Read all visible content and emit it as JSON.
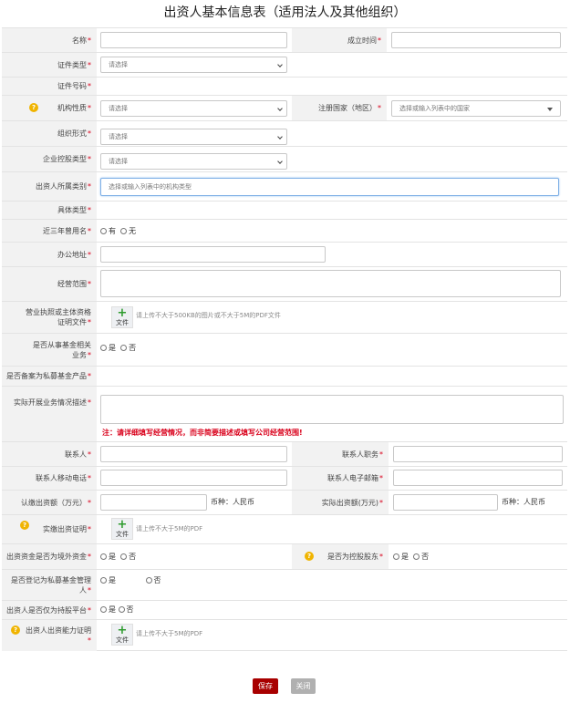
{
  "title": "出资人基本信息表（适用法人及其他组织）",
  "star": "*",
  "help_glyph": "?",
  "select_placeholder": "请选择",
  "fields": {
    "name": "名称",
    "established": "成立时间",
    "cert_type": "证件类型",
    "cert_no": "证件号码",
    "org_nature": "机构性质",
    "reg_country": "注册国家（地区）",
    "reg_country_placeholder": "选择或输入列表中的国家",
    "org_form": "组织形式",
    "enterprise_holding": "企业控股类型",
    "investor_category": "出资人所属类别",
    "investor_category_placeholder": "选择或输入列表中的机构类型",
    "specific_type": "具体类型",
    "former_name": "近三年曾用名",
    "former_yes": "有",
    "former_no": "无",
    "office_address": "办公地址",
    "business_scope": "经营范围",
    "license_1": "营业执照或主体资格",
    "license_2": "证明文件",
    "license_hint": "请上传不大于500KB的图片或不大于5M的PDF文件",
    "fund_business_1": "是否从事基金相关",
    "fund_business_2": "业务",
    "yes": "是",
    "no": "否",
    "private_fund_filed": "是否备案为私募基金产品",
    "actual_business": "实际开展业务情况描述",
    "actual_business_warning": "注：请详细填写经营情况，而非简要描述或填写公司经营范围!",
    "contact": "联系人",
    "contact_position": "联系人职务",
    "contact_mobile": "联系人移动电话",
    "contact_email": "联系人电子邮箱",
    "subscribed_capital": "认缴出资额（万元）",
    "currency_rmb": "币种：人民币",
    "paid_capital": "实际出资额(万元)",
    "paid_proof": "实缴出资证明",
    "pdf_hint": "请上传不大于5M的PDF",
    "overseas_funds": "出资资金是否为境外资金",
    "controlling_shareholder": "是否为控股股东",
    "pfm_registered_1": "是否登记为私募基金管理",
    "pfm_registered_2": "人",
    "holding_platform": "出资人是否仅为持股平台",
    "capability_proof": "出资人出资能力证明"
  },
  "upload_label": "文件",
  "buttons": {
    "save": "保存",
    "close": "关闭"
  },
  "colors": {
    "accent": "#a80000",
    "required": "#d9001b",
    "help": "#f0b400",
    "disabled": "#b0b0b0"
  }
}
